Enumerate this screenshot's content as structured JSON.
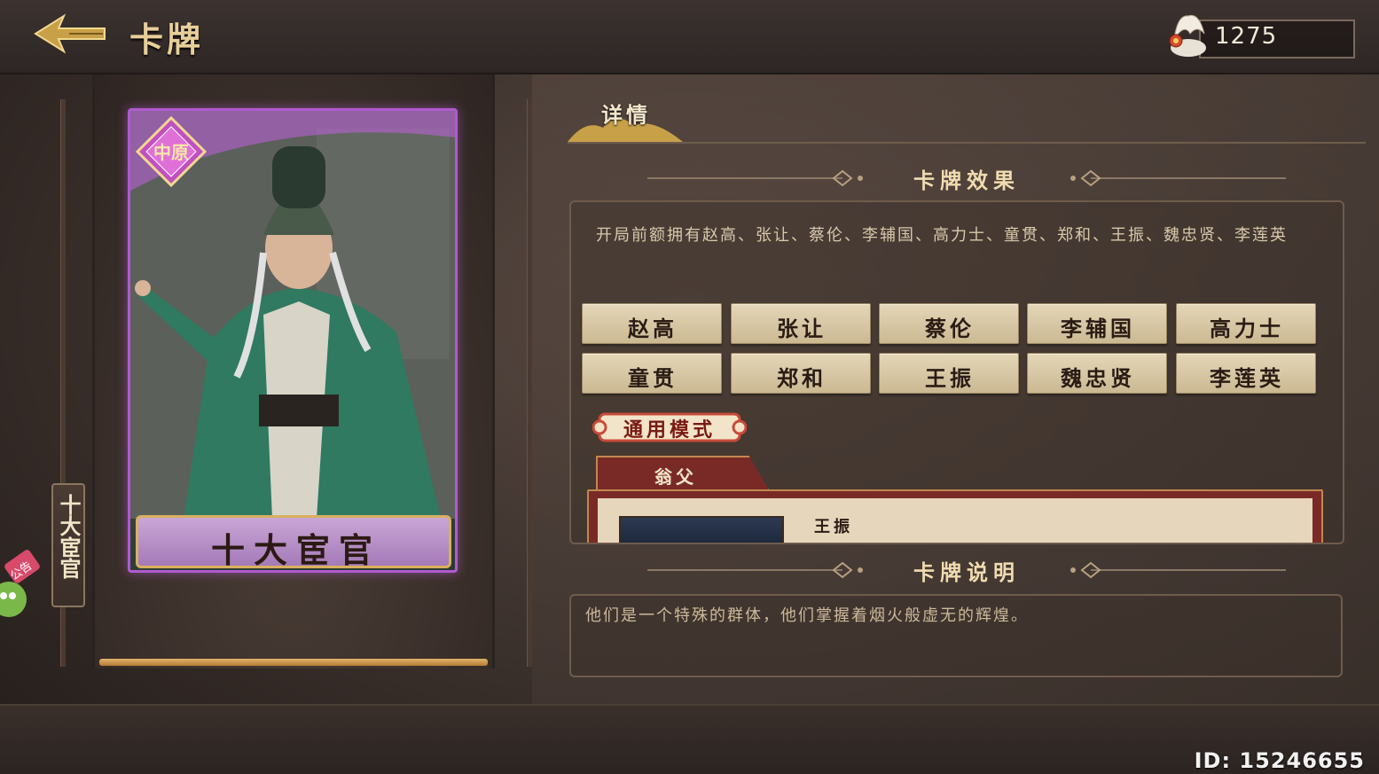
{
  "header": {
    "title": "卡牌",
    "currency_value": "1275"
  },
  "card": {
    "badge_text": "中原",
    "name": "十大宦官",
    "vertical_tag": "十大宦官"
  },
  "notice": {
    "label": "公告"
  },
  "tabs": {
    "detail": "详情"
  },
  "effect_section": {
    "title": "卡牌效果",
    "text": "开局前额拥有赵高、张让、蔡伦、李辅国、高力士、童贯、郑和、王振、魏忠贤、李莲英",
    "names": [
      "赵高",
      "张让",
      "蔡伦",
      "李辅国",
      "高力士",
      "童贯",
      "郑和",
      "王振",
      "魏忠贤",
      "李莲英"
    ],
    "mode_tag": "通用模式",
    "skill_tab": "翁父",
    "skill_entry_name": "王振"
  },
  "description_section": {
    "title": "卡牌说明",
    "text": "他们是一个特殊的群体，他们掌握着烟火般虚无的辉煌。"
  },
  "footer": {
    "player_id": "ID: 15246655"
  },
  "colors": {
    "accent_gold": "#e4b26a",
    "card_frame_purple": "#b05ad0",
    "skill_red": "#7a2a26"
  }
}
